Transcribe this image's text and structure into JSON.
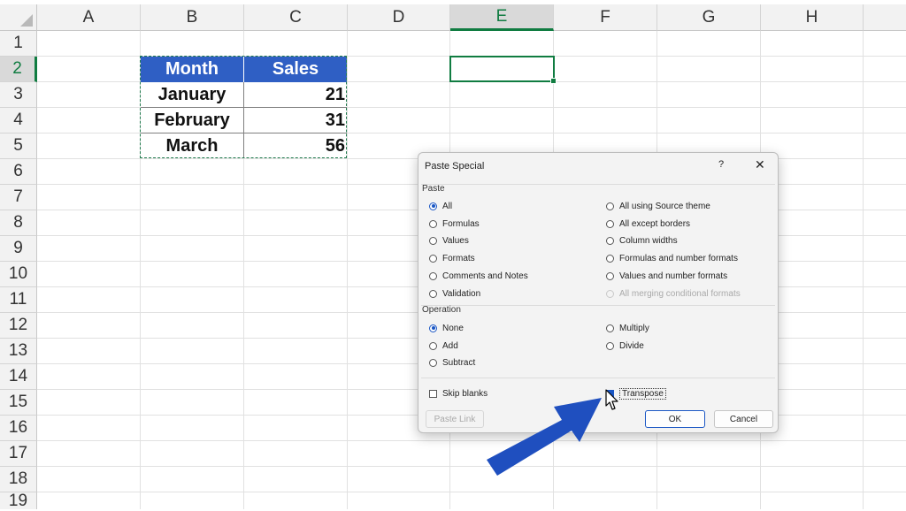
{
  "spreadsheet": {
    "columns": [
      "A",
      "B",
      "C",
      "D",
      "E",
      "F",
      "G",
      "H"
    ],
    "selected_column": "E",
    "rows": [
      "1",
      "2",
      "3",
      "4",
      "5",
      "6",
      "7",
      "8",
      "9",
      "10",
      "11",
      "12",
      "13",
      "14",
      "15",
      "16",
      "17",
      "18",
      "19"
    ],
    "selected_row": "2",
    "table": {
      "headers": [
        "Month",
        "Sales"
      ],
      "rows": [
        [
          "January",
          "21"
        ],
        [
          "February",
          "31"
        ],
        [
          "March",
          "56"
        ]
      ]
    }
  },
  "dialog": {
    "title": "Paste Special",
    "help": "?",
    "close": "✕",
    "paste_group": "Paste",
    "paste_left": [
      "All",
      "Formulas",
      "Values",
      "Formats",
      "Comments and Notes",
      "Validation"
    ],
    "paste_right": [
      "All using Source theme",
      "All except borders",
      "Column widths",
      "Formulas and number formats",
      "Values and number formats",
      "All merging conditional formats"
    ],
    "paste_selected": "All",
    "operation_group": "Operation",
    "operation_left": [
      "None",
      "Add",
      "Subtract"
    ],
    "operation_right": [
      "Multiply",
      "Divide"
    ],
    "operation_selected": "None",
    "skip_blanks": "Skip blanks",
    "transpose": "Transpose",
    "paste_link": "Paste Link",
    "ok": "OK",
    "cancel": "Cancel"
  },
  "colors": {
    "table_header": "#2f5fc4",
    "excel_green": "#107c41",
    "arrow": "#1f4fbf"
  }
}
